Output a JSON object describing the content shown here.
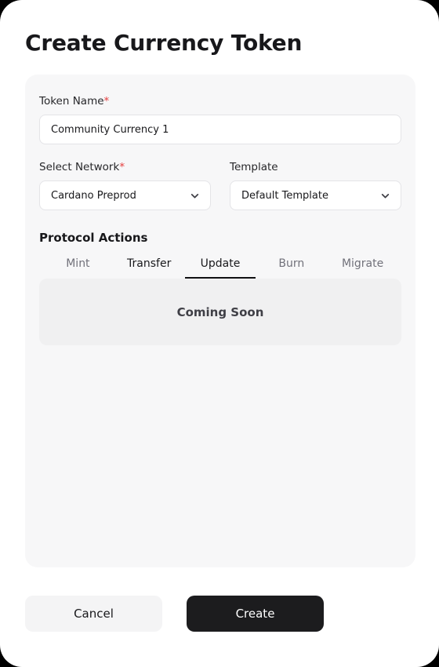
{
  "window": {
    "title": "Create Currency Token"
  },
  "form": {
    "token_name": {
      "label": "Token Name",
      "required_marker": "*",
      "value": "Community Currency 1",
      "placeholder": "Token Name"
    },
    "network": {
      "label": "Select Network",
      "required_marker": "*",
      "value": "Cardano Preprod",
      "chevron_icon": "chevron-down-icon"
    },
    "template": {
      "label": "Template",
      "value": "Default Template",
      "chevron_icon": "chevron-down-icon"
    }
  },
  "protocol_actions": {
    "title": "Protocol Actions",
    "tabs": [
      {
        "label": "Mint",
        "state": "inactive"
      },
      {
        "label": "Transfer",
        "state": "emphasis"
      },
      {
        "label": "Update",
        "state": "active"
      },
      {
        "label": "Burn",
        "state": "inactive"
      },
      {
        "label": "Migrate",
        "state": "inactive"
      }
    ],
    "panel": {
      "message": "Coming Soon"
    }
  },
  "footer": {
    "cancel_label": "Cancel",
    "create_label": "Create"
  },
  "colors": {
    "accent_required": "#e53e3e",
    "primary_button_bg": "#1c1c1e",
    "card_bg": "#f7f7f8",
    "panel_bg": "#f0f0f1",
    "active_tab_underline": "#111113",
    "muted_text": "#71717a"
  }
}
